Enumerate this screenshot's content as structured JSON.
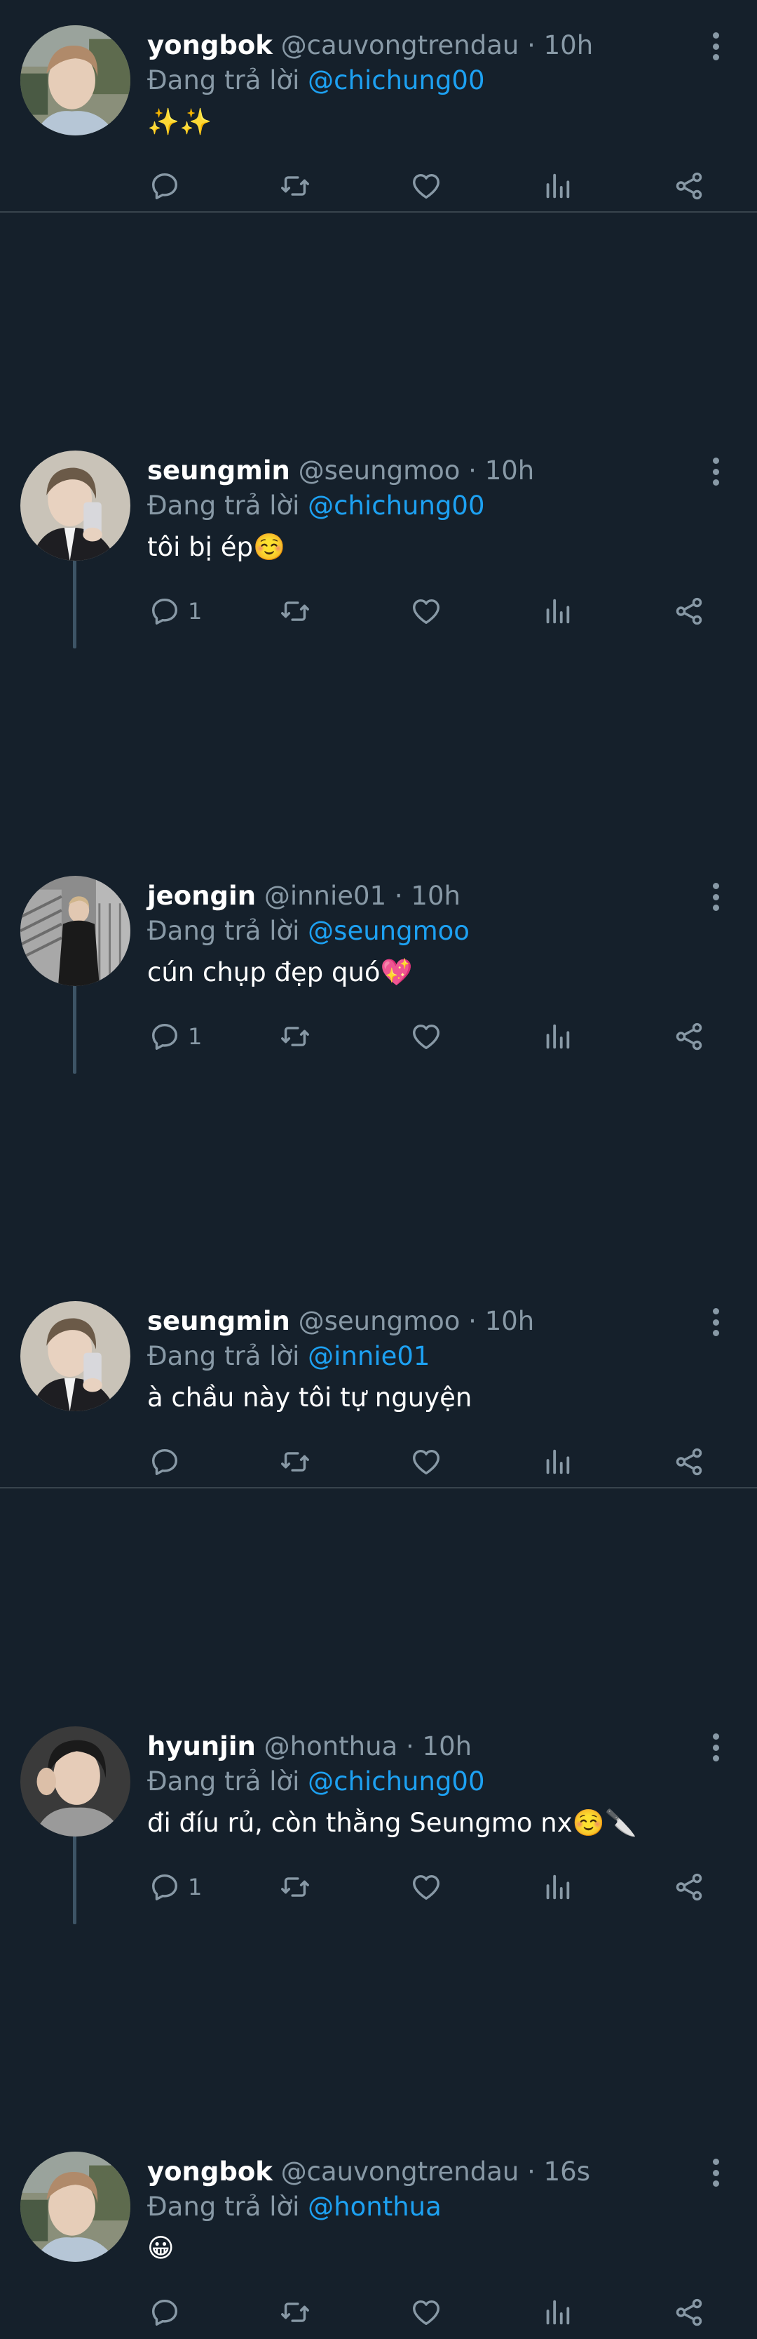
{
  "colors": {
    "background": "#15202b",
    "separator": "#38444d",
    "muted": "#8899a6",
    "link": "#1da1f2",
    "thread_line": "#3d5466"
  },
  "reply_prefix": "Đang trả lời",
  "tweets": [
    {
      "name": "yongbok",
      "handle": "@cauvongtrendau",
      "separator": "·",
      "time": "10h",
      "replying_to": "@chichung00",
      "text": "✨✨",
      "reply_count": "",
      "avatar": "avatar-yongbok"
    },
    {
      "name": "seungmin",
      "handle": "@seungmoo",
      "separator": "·",
      "time": "10h",
      "replying_to": "@chichung00",
      "text": "tôi bị ép☺️",
      "reply_count": "1",
      "avatar": "avatar-seungmin"
    },
    {
      "name": "jeongin",
      "handle": "@innie01",
      "separator": "·",
      "time": "10h",
      "replying_to": "@seungmoo",
      "text": "cún chụp đẹp quó💖",
      "reply_count": "1",
      "avatar": "avatar-jeongin"
    },
    {
      "name": "seungmin",
      "handle": "@seungmoo",
      "separator": "·",
      "time": "10h",
      "replying_to": "@innie01",
      "text": "à chầu này tôi tự nguyện",
      "reply_count": "",
      "avatar": "avatar-seungmin"
    },
    {
      "name": "hyunjin",
      "handle": "@honthua",
      "separator": "·",
      "time": "10h",
      "replying_to": "@chichung00",
      "text": "đi đíu rủ, còn thằng Seungmo nx☺️🔪",
      "reply_count": "1",
      "avatar": "avatar-hyunjin"
    },
    {
      "name": "yongbok",
      "handle": "@cauvongtrendau",
      "separator": "·",
      "time": "16s",
      "replying_to": "@honthua",
      "text": "😀",
      "reply_count": "",
      "avatar": "avatar-yongbok"
    }
  ],
  "icons": {
    "reply": "reply-icon",
    "retweet": "retweet-icon",
    "like": "heart-icon",
    "views": "views-icon",
    "share": "share-icon",
    "more": "more-vertical-icon"
  }
}
